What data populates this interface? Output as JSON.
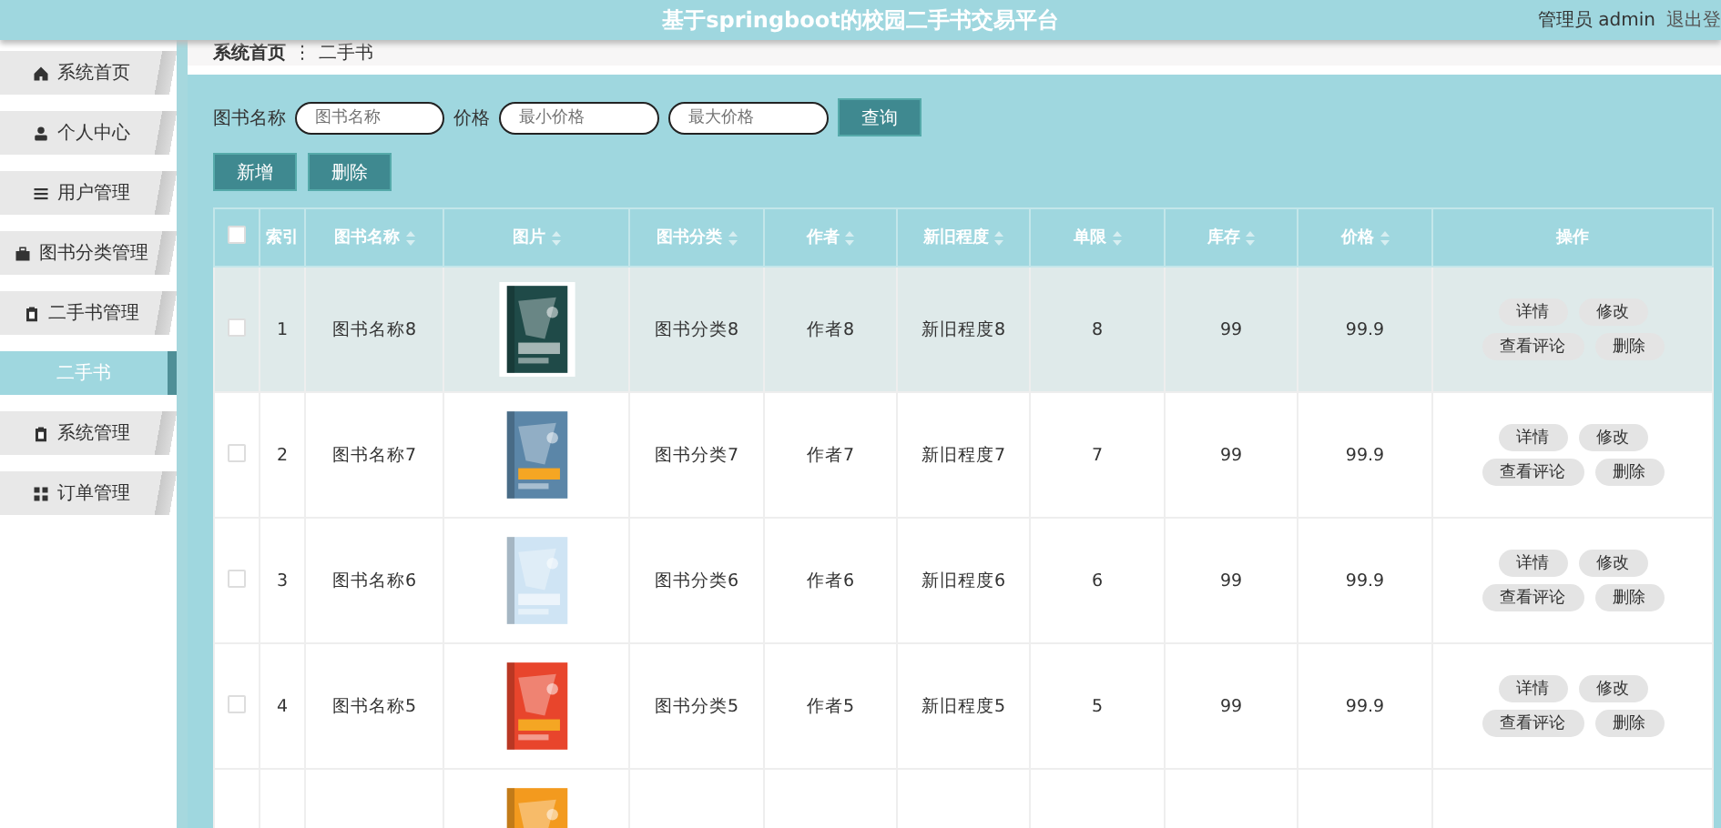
{
  "header": {
    "title": "基于springboot的校园二手书交易平台",
    "user": "管理员 admin",
    "logout": "退出登"
  },
  "sidebar": {
    "items": [
      {
        "label": "系统首页",
        "selected": false
      },
      {
        "label": "个人中心",
        "selected": false
      },
      {
        "label": "用户管理",
        "selected": false
      },
      {
        "label": "图书分类管理",
        "selected": false
      },
      {
        "label": "二手书管理",
        "selected": false
      },
      {
        "label": "二手书",
        "selected": true
      },
      {
        "label": "系统管理",
        "selected": false
      },
      {
        "label": "订单管理",
        "selected": false
      }
    ]
  },
  "breadcrumb": {
    "items": [
      "系统首页",
      "二手书"
    ],
    "separator": "⋮"
  },
  "search": {
    "name_label": "图书名称",
    "name_placeholder": "图书名称",
    "price_label": "价格",
    "min_placeholder": "最小价格",
    "max_placeholder": "最大价格",
    "button": "查询"
  },
  "actions": [
    "新增",
    "删除"
  ],
  "table": {
    "select_all_checked": false,
    "columns": [
      {
        "label": "索引",
        "sortable": false
      },
      {
        "label": "图书名称",
        "sortable": true
      },
      {
        "label": "图片",
        "sortable": true
      },
      {
        "label": "图书分类",
        "sortable": true
      },
      {
        "label": "作者",
        "sortable": true
      },
      {
        "label": "新旧程度",
        "sortable": true
      },
      {
        "label": "单限",
        "sortable": true
      },
      {
        "label": "库存",
        "sortable": true
      },
      {
        "label": "价格",
        "sortable": true
      },
      {
        "label": "操作",
        "sortable": false
      }
    ],
    "rows": [
      {
        "highlighted": true,
        "checked": false,
        "index": "1",
        "name": "图书名称8",
        "category": "图书分类8",
        "author": "作者8",
        "condition": "新旧程度8",
        "limit": "8",
        "stock": "99",
        "price": "99.9",
        "buttons": [
          "详情",
          "修改",
          "查看评论",
          "删除"
        ]
      },
      {
        "highlighted": false,
        "checked": false,
        "index": "2",
        "name": "图书名称7",
        "category": "图书分类7",
        "author": "作者7",
        "condition": "新旧程度7",
        "limit": "7",
        "stock": "99",
        "price": "99.9",
        "buttons": [
          "详情",
          "修改",
          "查看评论",
          "删除"
        ]
      },
      {
        "highlighted": false,
        "checked": false,
        "index": "3",
        "name": "图书名称6",
        "category": "图书分类6",
        "author": "作者6",
        "condition": "新旧程度6",
        "limit": "6",
        "stock": "99",
        "price": "99.9",
        "buttons": [
          "详情",
          "修改",
          "查看评论",
          "删除"
        ]
      },
      {
        "highlighted": false,
        "checked": false,
        "index": "4",
        "name": "图书名称5",
        "category": "图书分类5",
        "author": "作者5",
        "condition": "新旧程度5",
        "limit": "5",
        "stock": "99",
        "price": "99.9",
        "buttons": [
          "详情",
          "修改",
          "查看评论",
          "删除"
        ]
      },
      {
        "kind": "partial",
        "highlighted": false
      }
    ]
  }
}
